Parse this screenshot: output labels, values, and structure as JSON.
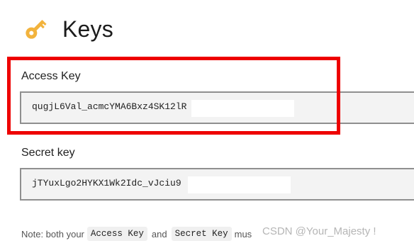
{
  "header": {
    "title": "Keys",
    "icon": "key-icon"
  },
  "access_key": {
    "label": "Access Key",
    "value": "qugjL6Val_acmcYMA6Bxz4SK12lR"
  },
  "secret_key": {
    "label": "Secret key",
    "value": "jTYuxLgo2HYKX1Wk2Idc_vJciu9"
  },
  "note": {
    "prefix": "Note: both your",
    "code1": "Access Key",
    "and": "and",
    "code2": "Secret Key",
    "suffix": "mus"
  },
  "watermark": "CSDN @Your_Majesty !",
  "colors": {
    "highlight": "#ee0000",
    "key_icon": "#f2b33d"
  }
}
